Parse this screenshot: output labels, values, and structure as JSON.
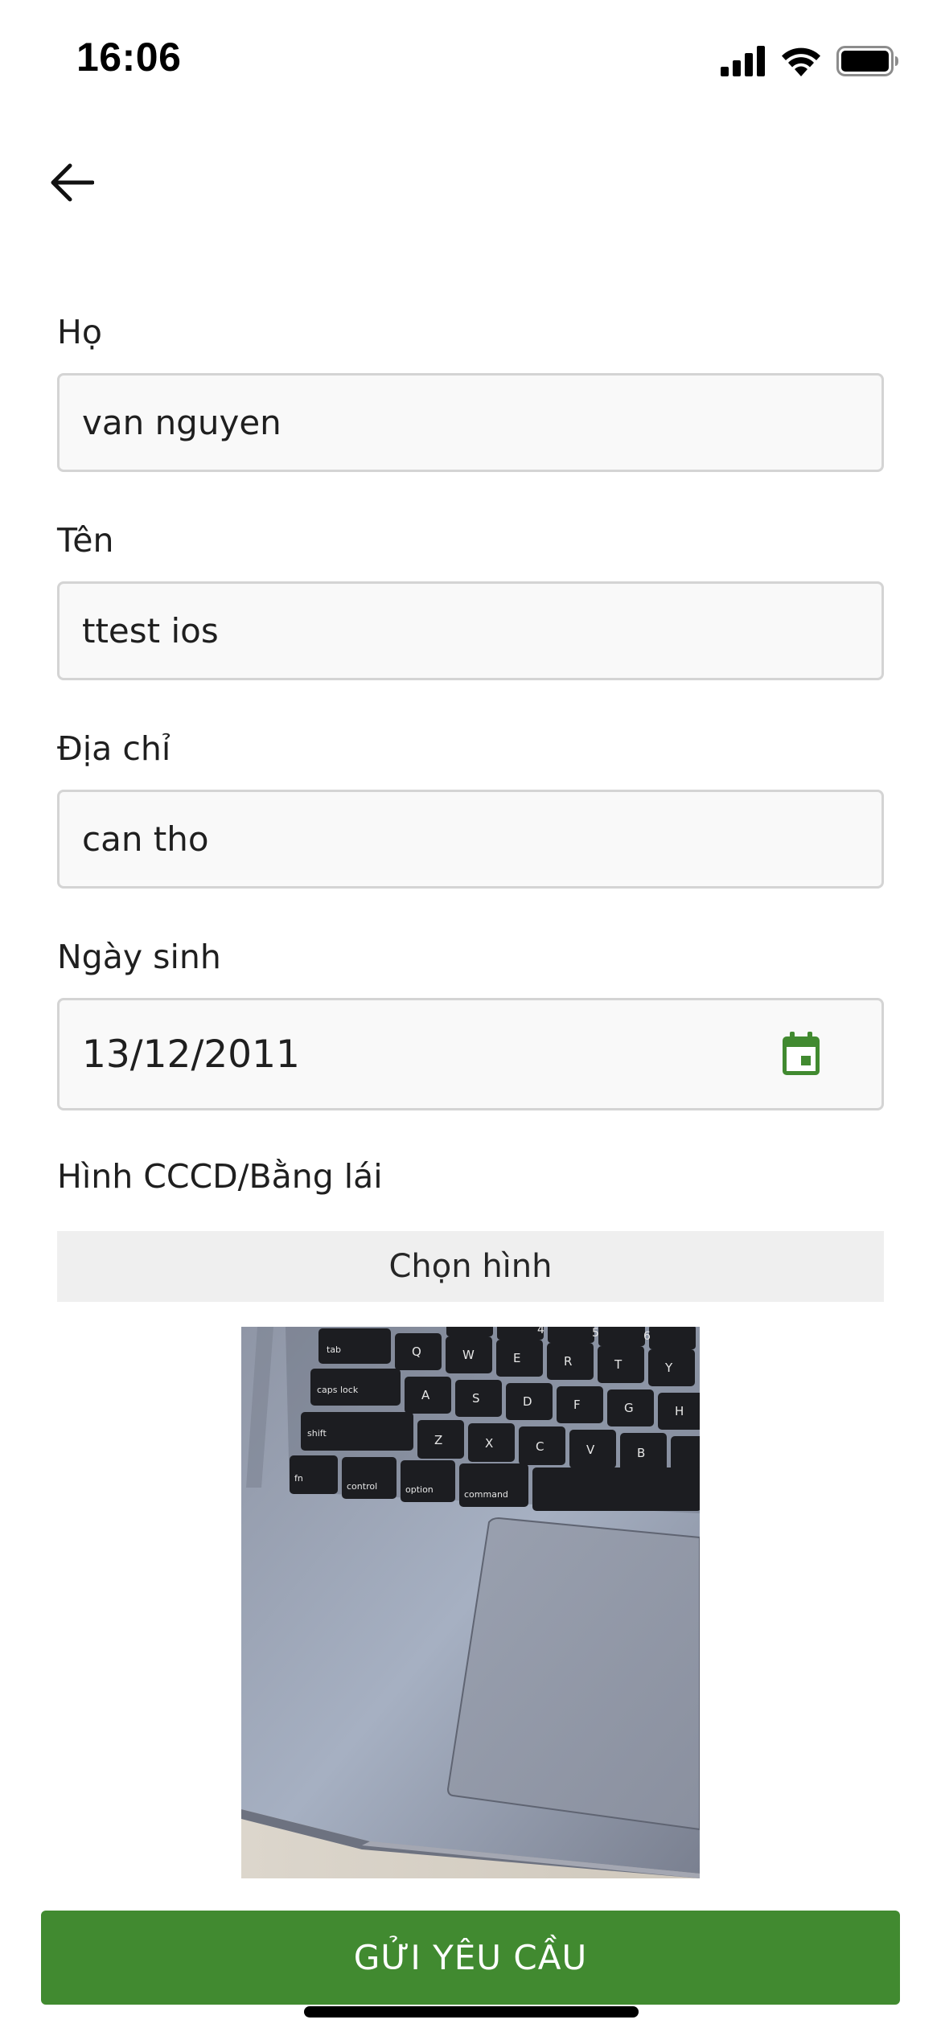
{
  "status_bar": {
    "time": "16:06",
    "icons": [
      "signal-icon",
      "wifi-icon",
      "battery-icon"
    ]
  },
  "header": {
    "back_icon": "arrow-left-icon"
  },
  "form": {
    "last_name": {
      "label": "Họ",
      "value": "van nguyen"
    },
    "first_name": {
      "label": "Tên",
      "value": "ttest ios"
    },
    "address": {
      "label": "Địa chỉ",
      "value": "can tho"
    },
    "birth_date": {
      "label": "Ngày sinh",
      "value": "13/12/2011",
      "icon": "calendar-icon"
    },
    "id_image": {
      "label": "Hình CCCD/Bằng lái",
      "button_label": "Chọn hình"
    }
  },
  "photo": {
    "keys_row1": [
      "tab",
      "Q",
      "W",
      "E",
      "R",
      "T",
      "Y"
    ],
    "keys_row2": [
      "caps lock",
      "A",
      "S",
      "D",
      "F",
      "G",
      "H"
    ],
    "keys_row3": [
      "shift",
      "Z",
      "X",
      "C",
      "V",
      "B"
    ],
    "keys_row4": [
      "fn",
      "control",
      "option",
      "command"
    ],
    "numbers": [
      "4",
      "5",
      "6"
    ]
  },
  "submit_label": "GỬI YÊU CẦU",
  "colors": {
    "accent": "#418a30",
    "field_border": "#d4d4d4",
    "field_bg": "#f9f9f9"
  }
}
